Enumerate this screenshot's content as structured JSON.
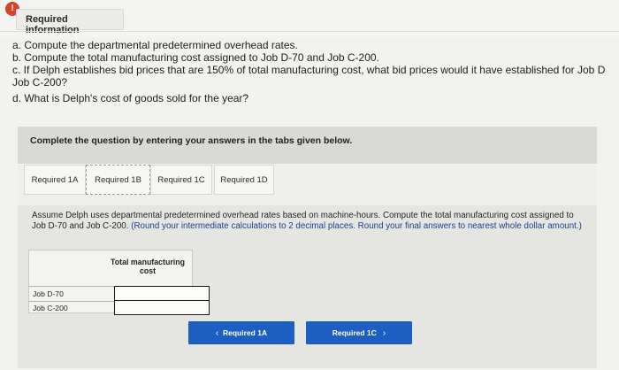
{
  "header": {
    "icon_glyph": "!",
    "tab_label": "Required information"
  },
  "questions": {
    "a": "a. Compute the departmental predetermined overhead rates.",
    "b": "b. Compute the total manufacturing cost assigned to Job D-70 and Job C-200.",
    "c_line1": "c. If Delph establishes bid prices that are 150% of total manufacturing cost, what bid prices would it have established for Job D",
    "c_line2": "Job C-200?",
    "d": "d. What is Delph's cost of goods sold for the year?"
  },
  "banner": {
    "text": "Complete the question by entering your answers in the tabs given below."
  },
  "tabs": [
    {
      "label": "Required 1A",
      "active": false
    },
    {
      "label": "Required 1B",
      "active": true
    },
    {
      "label": "Required 1C",
      "active": false
    },
    {
      "label": "Required 1D",
      "active": false
    }
  ],
  "instructions": {
    "main": "Assume Delph uses departmental predetermined overhead rates based on machine-hours. Compute the total manufacturing cost assigned to Job D-70 and Job C-200. ",
    "note": "(Round your intermediate calculations to 2 decimal places. Round your final answers to nearest whole dollar amount.)"
  },
  "table": {
    "column_header": "Total manufacturing cost",
    "rows": [
      {
        "label": "Job D-70",
        "value": ""
      },
      {
        "label": "Job C-200",
        "value": ""
      }
    ]
  },
  "nav": {
    "prev_label": "Required 1A",
    "next_label": "Required 1C",
    "prev_icon": "chevron-left-icon",
    "next_icon": "chevron-right-icon"
  },
  "colors": {
    "accent": "#1c5fc0",
    "alert": "#d2452a"
  }
}
